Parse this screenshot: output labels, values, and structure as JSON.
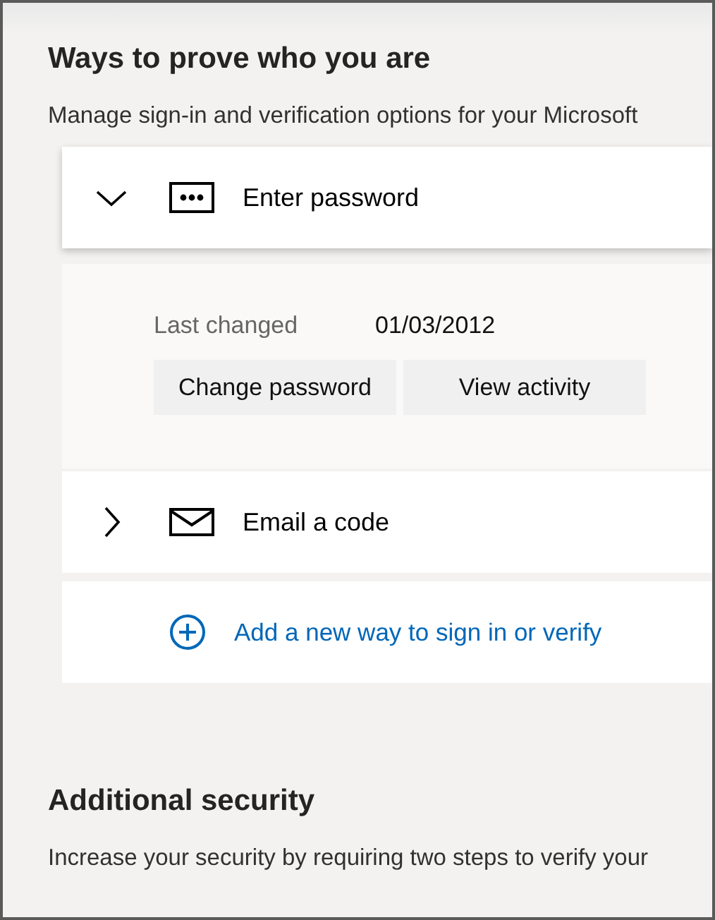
{
  "section": {
    "title": "Ways to prove who you are",
    "description": "Manage sign-in and verification options for your Microsoft"
  },
  "methods": [
    {
      "label": "Enter password",
      "kind": "password",
      "expanded": true,
      "details": {
        "label": "Last changed",
        "value": "01/03/2012",
        "buttons": [
          "Change password",
          "View activity"
        ]
      }
    },
    {
      "label": "Email a code",
      "kind": "email",
      "expanded": false
    }
  ],
  "add_link": "Add a new way to sign in or verify",
  "additional": {
    "title": "Additional security",
    "description": "Increase your security by requiring two steps to verify your"
  }
}
